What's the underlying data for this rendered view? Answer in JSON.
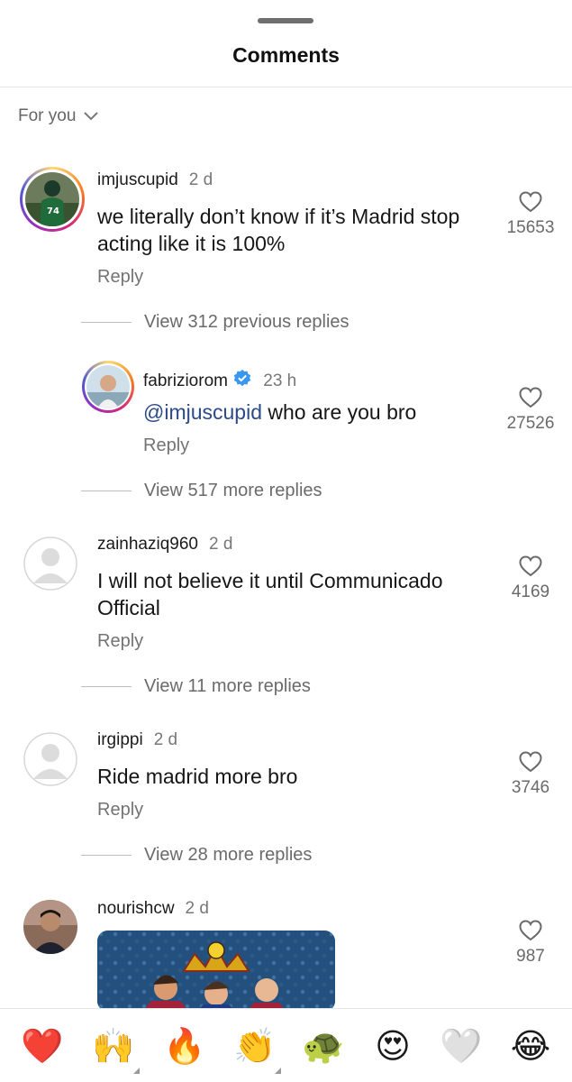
{
  "header": {
    "title": "Comments"
  },
  "sort": {
    "label": "For you"
  },
  "comments": [
    {
      "username": "imjuscupid",
      "time": "2 d",
      "text": "we literally don’t know if it’s Madrid stop acting like it is 100%",
      "reply_label": "Reply",
      "likes": "15653",
      "view_replies": "View 312 previous replies"
    },
    {
      "username": "fabriziorom",
      "time": "23 h",
      "mention": "@imjuscupid",
      "text": " who are you bro",
      "reply_label": "Reply",
      "likes": "27526",
      "view_replies": "View 517 more replies"
    },
    {
      "username": "zainhaziq960",
      "time": "2 d",
      "text": "I will not believe it until Communicado Official",
      "reply_label": "Reply",
      "likes": "4169",
      "view_replies": "View 11 more replies"
    },
    {
      "username": "irgippi",
      "time": "2 d",
      "text": "Ride madrid more bro",
      "reply_label": "Reply",
      "likes": "3746",
      "view_replies": "View 28 more replies"
    },
    {
      "username": "nourishcw",
      "time": "2 d",
      "likes": "987"
    }
  ],
  "emoji_bar": [
    {
      "name": "red-heart",
      "glyph": "❤️"
    },
    {
      "name": "raising-hands",
      "glyph": "🙌"
    },
    {
      "name": "fire",
      "glyph": "🔥"
    },
    {
      "name": "clapping-hands",
      "glyph": "👏"
    },
    {
      "name": "turtle",
      "glyph": "🐢"
    },
    {
      "name": "heart-eyes",
      "glyph": "😍"
    },
    {
      "name": "white-heart",
      "glyph": "🤍"
    },
    {
      "name": "tears-of-joy",
      "glyph": "😂"
    }
  ],
  "colors": {
    "mention": "#2a4a8a",
    "verified": "#3897f0",
    "muted": "#737373"
  }
}
